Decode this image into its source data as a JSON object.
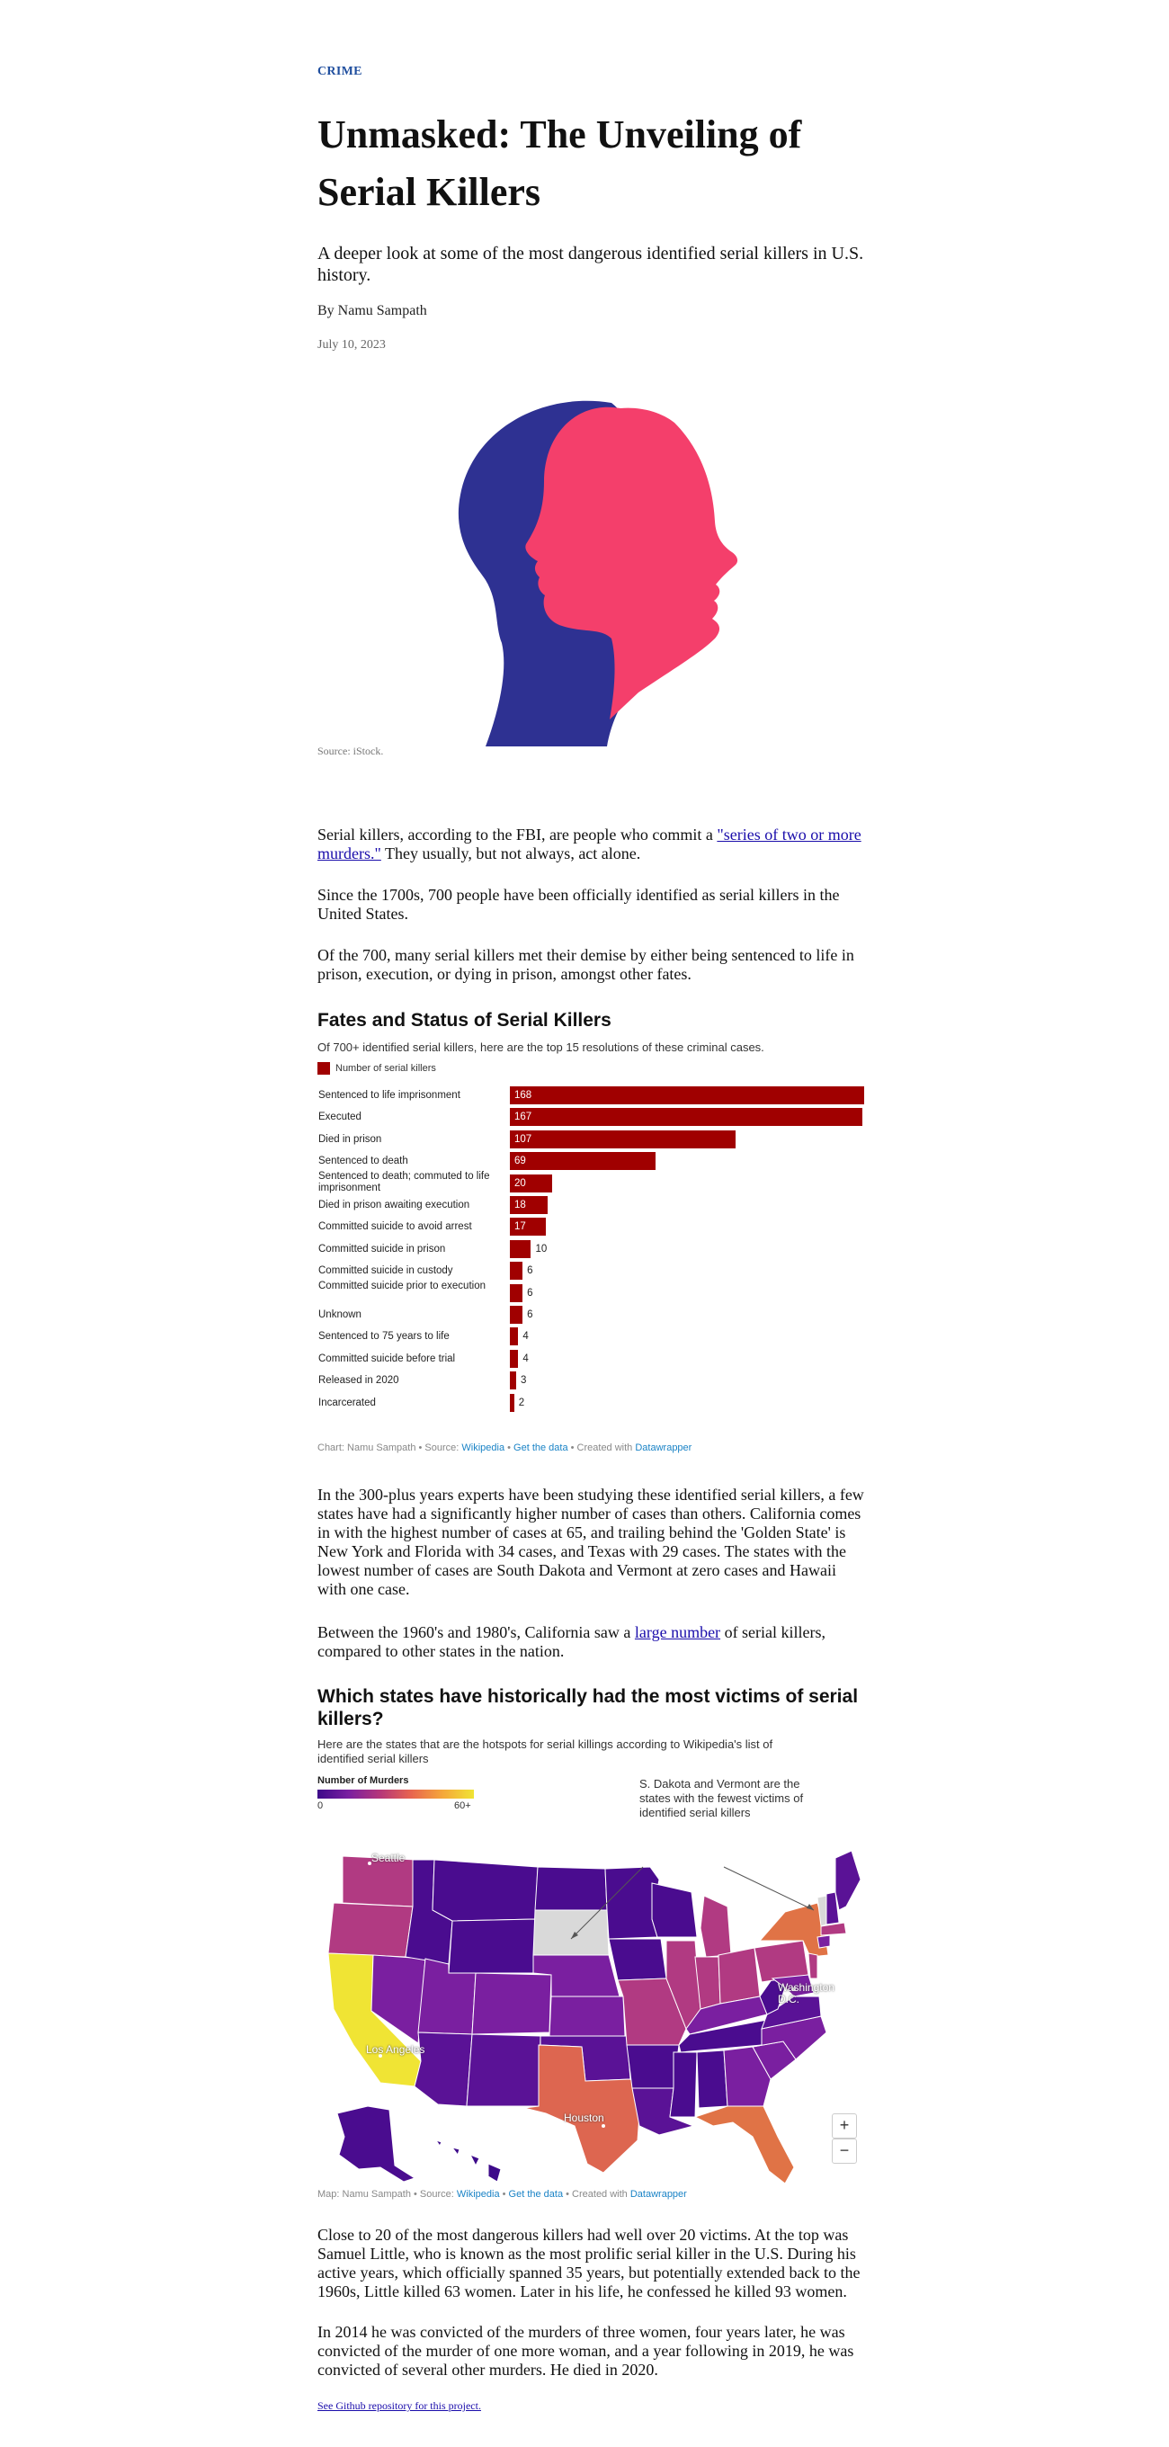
{
  "article": {
    "kicker": "CRIME",
    "headline_line1": "Unmasked: The Unveiling of",
    "headline_line2": "Serial Killers",
    "dek": "A deeper look at some of the most dangerous identified serial killers in U.S. history.",
    "byline": "By Namu Sampath",
    "date": "July 10, 2023",
    "image_credit": "Source: iStock.",
    "p1_pre": "Serial killers, according to the FBI, are people who commit a ",
    "p1_link": "\"series of two or more murders.\"",
    "p1_post": " They usually, but not always, act alone.",
    "p2": "Since the 1700s, 700 people have been officially identified as serial killers in the United States.",
    "p3": "Of the 700, many serial killers met their demise by either being sentenced to life in prison, execution, or dying in prison, amongst other fates.",
    "p4": "In the 300-plus years experts have been studying these identified serial killers, a few states have had a significantly higher number of cases than others. California comes in with the highest number of cases at 65, and trailing behind the 'Golden State' is New York and Florida with 34 cases, and Texas with 29 cases. The states with the lowest number of cases are South Dakota and Vermont at zero cases and Hawaii with one case.",
    "p5_pre": "Between the 1960's and 1980's, California saw a ",
    "p5_link": "large number",
    "p5_post": " of serial killers, compared to other states in the nation.",
    "p6": "Close to 20 of the most dangerous killers had well over 20 victims. At the top was Samuel Little, who is known as the most prolific serial killer in the U.S. During his active years, which officially spanned 35 years, but potentially extended back to the 1960s, Little killed 63 women. Later in his life, he confessed he killed 93 women.",
    "p7": "In 2014 he was convicted of the murders of three women, four years later, he was convicted of the murder of one more woman, and a year following in 2019, he was convicted of several other murders. He died in 2020.",
    "github_link": "See Github repository for this project."
  },
  "chart_data": [
    {
      "type": "bar",
      "title": "Fates and Status of Serial Killers",
      "subtitle": "Of 700+ identified serial killers, here are the top 15 resolutions of these criminal cases.",
      "legend": "Number of serial killers",
      "color": "#a00000",
      "categories": [
        "Sentenced to life imprisonment",
        "Executed",
        "Died in prison",
        "Sentenced to death",
        "Sentenced to death; commuted to life imprisonment",
        "Died in prison awaiting execution",
        "Committed suicide to avoid arrest",
        "Committed suicide in prison",
        "Committed suicide in custody",
        "Committed suicide prior to execution",
        "Unknown",
        "Sentenced to 75 years to life",
        "Committed suicide before trial",
        "Released in 2020",
        "Incarcerated"
      ],
      "values": [
        168,
        167,
        107,
        69,
        20,
        18,
        17,
        10,
        6,
        6,
        6,
        4,
        4,
        3,
        2
      ],
      "footnote": {
        "prefix": "Chart: Namu Sampath • Source: ",
        "source": "Wikipedia",
        "sep": " • ",
        "data": "Get the data",
        "created": " • Created with ",
        "tool": "Datawrapper"
      }
    },
    {
      "type": "heatmap",
      "title": "Which states have historically had the most victims of serial killers?",
      "subtitle": "Here are the states that are the hotspots for serial killings according to Wikipedia's list of identified serial killers",
      "legend_title": "Number of Murders",
      "legend_min": "0",
      "legend_max": "60+",
      "annotation": "S. Dakota and Vermont are the states with the fewest victims of identified serial killers",
      "city_labels": [
        "Seattle",
        "Los Angeles",
        "Houston",
        "Washington D.C."
      ],
      "highlighted_values": {
        "California": 65,
        "New York": 34,
        "Florida": 34,
        "Texas": 29,
        "South Dakota": 0,
        "Vermont": 0,
        "Hawaii": 1
      },
      "colors": {
        "low": "#3d0a8a",
        "mid": "#b5367a",
        "high": "#f0e434",
        "none": "#d9d9d9"
      },
      "zoom_in": "+",
      "zoom_out": "−",
      "footnote": {
        "prefix": "Map: Namu Sampath • Source: ",
        "source": "Wikipedia",
        "sep": " • ",
        "data": "Get the data",
        "created": " • Created with ",
        "tool": "Datawrapper"
      }
    }
  ]
}
